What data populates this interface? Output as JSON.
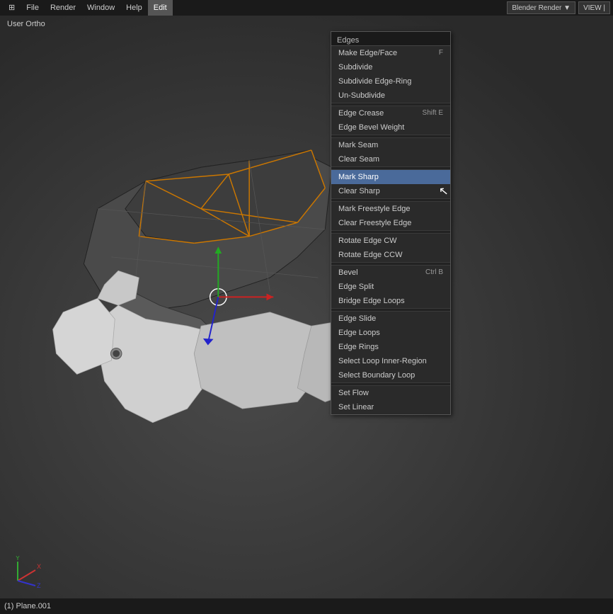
{
  "topbar": {
    "items": [
      "⊞",
      "File",
      "Render",
      "Window",
      "Help"
    ],
    "mode": "Edit",
    "right_items": [
      "Blender Render",
      "VIEV |"
    ],
    "mode_label": "Edit"
  },
  "viewport": {
    "label": "User Ortho"
  },
  "menu": {
    "title": "Edges",
    "items": [
      {
        "label": "Make Edge/Face",
        "shortcut": "F",
        "separator_after": false,
        "active": false
      },
      {
        "label": "Subdivide",
        "shortcut": "",
        "separator_after": false,
        "active": false
      },
      {
        "label": "Subdivide Edge-Ring",
        "shortcut": "",
        "separator_after": false,
        "active": false
      },
      {
        "label": "Un-Subdivide",
        "shortcut": "",
        "separator_after": true,
        "active": false
      },
      {
        "label": "Edge Crease",
        "shortcut": "Shift E",
        "separator_after": false,
        "active": false
      },
      {
        "label": "Edge Bevel Weight",
        "shortcut": "",
        "separator_after": true,
        "active": false
      },
      {
        "label": "Mark Seam",
        "shortcut": "",
        "separator_after": false,
        "active": false
      },
      {
        "label": "Clear Seam",
        "shortcut": "",
        "separator_after": true,
        "active": false
      },
      {
        "label": "Mark Sharp",
        "shortcut": "",
        "separator_after": false,
        "active": true
      },
      {
        "label": "Clear Sharp",
        "shortcut": "",
        "separator_after": true,
        "active": false
      },
      {
        "label": "Mark Freestyle Edge",
        "shortcut": "",
        "separator_after": false,
        "active": false
      },
      {
        "label": "Clear Freestyle Edge",
        "shortcut": "",
        "separator_after": true,
        "active": false
      },
      {
        "label": "Rotate Edge CW",
        "shortcut": "",
        "separator_after": false,
        "active": false
      },
      {
        "label": "Rotate Edge CCW",
        "shortcut": "",
        "separator_after": true,
        "active": false
      },
      {
        "label": "Bevel",
        "shortcut": "Ctrl B",
        "separator_after": false,
        "active": false
      },
      {
        "label": "Edge Split",
        "shortcut": "",
        "separator_after": false,
        "active": false
      },
      {
        "label": "Bridge Edge Loops",
        "shortcut": "",
        "separator_after": true,
        "active": false
      },
      {
        "label": "Edge Slide",
        "shortcut": "",
        "separator_after": false,
        "active": false
      },
      {
        "label": "Edge Loops",
        "shortcut": "",
        "separator_after": false,
        "active": false
      },
      {
        "label": "Edge Rings",
        "shortcut": "",
        "separator_after": false,
        "active": false
      },
      {
        "label": "Select Loop Inner-Region",
        "shortcut": "",
        "separator_after": false,
        "active": false
      },
      {
        "label": "Select Boundary Loop",
        "shortcut": "",
        "separator_after": true,
        "active": false
      },
      {
        "label": "Set Flow",
        "shortcut": "",
        "separator_after": false,
        "active": false
      },
      {
        "label": "Set Linear",
        "shortcut": "",
        "separator_after": false,
        "active": false
      }
    ]
  },
  "bottom_bar": {
    "info": "(1) Plane.001"
  },
  "colors": {
    "menu_bg": "#2a2a2a",
    "menu_active": "#4a6a9a",
    "header_bg": "#1a1a1a",
    "separator": "#222"
  }
}
